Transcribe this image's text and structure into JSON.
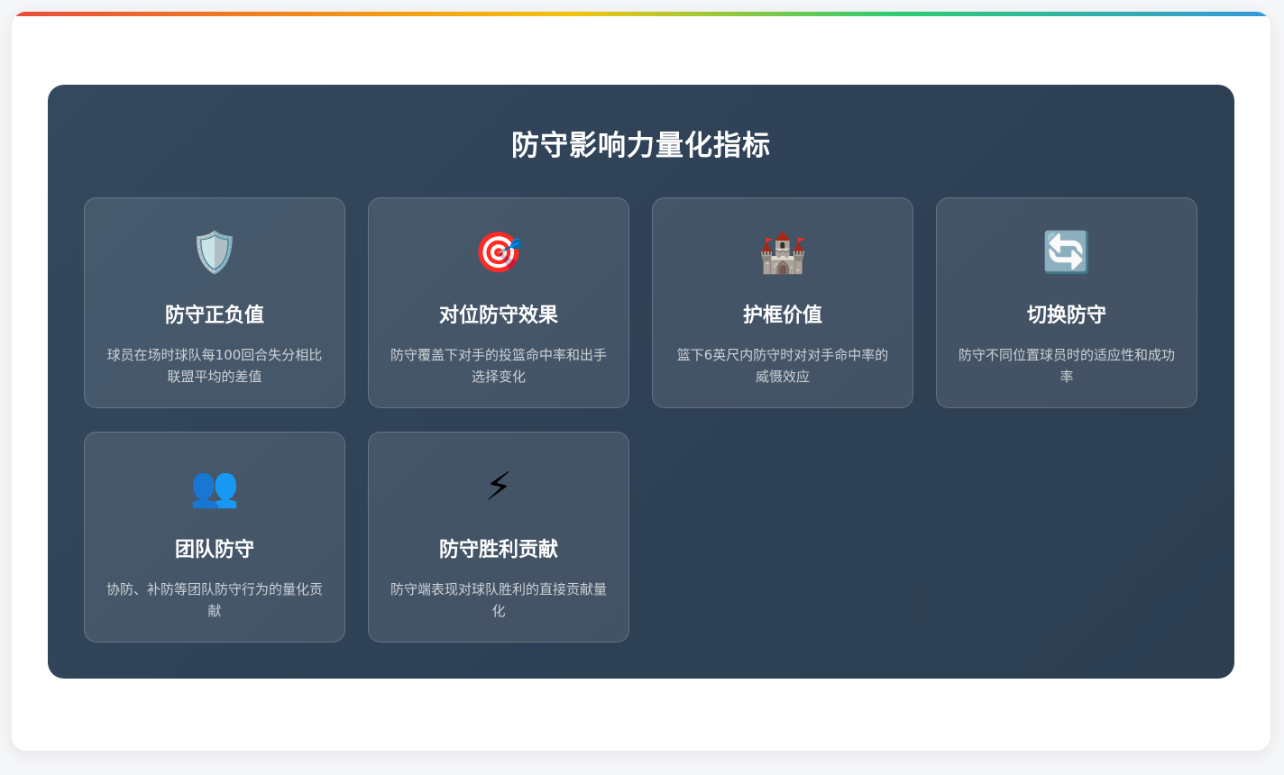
{
  "panel": {
    "title": "防守影响力量化指标"
  },
  "metrics": [
    {
      "icon": "🛡️",
      "icon_name": "shield-icon",
      "title": "防守正负值",
      "desc": "球员在场时球队每100回合失分相比联盟平均的差值"
    },
    {
      "icon": "🎯",
      "icon_name": "target-icon",
      "title": "对位防守效果",
      "desc": "防守覆盖下对手的投篮命中率和出手选择变化"
    },
    {
      "icon": "🏰",
      "icon_name": "castle-icon",
      "title": "护框价值",
      "desc": "篮下6英尺内防守时对对手命中率的威慑效应"
    },
    {
      "icon": "🔄",
      "icon_name": "switch-arrows-icon",
      "title": "切换防守",
      "desc": "防守不同位置球员时的适应性和成功率"
    },
    {
      "icon": "👥",
      "icon_name": "team-icon",
      "title": "团队防守",
      "desc": "协防、补防等团队防守行为的量化贡献"
    },
    {
      "icon": "⚡",
      "icon_name": "lightning-icon",
      "title": "防守胜利贡献",
      "desc": "防守端表现对球队胜利的直接贡献量化"
    }
  ],
  "colors": {
    "panel_bg": "#2f4156",
    "accent_gradient": [
      "#e74c3c",
      "#f39c12",
      "#f1c40f",
      "#2ecc71",
      "#3498db"
    ]
  }
}
